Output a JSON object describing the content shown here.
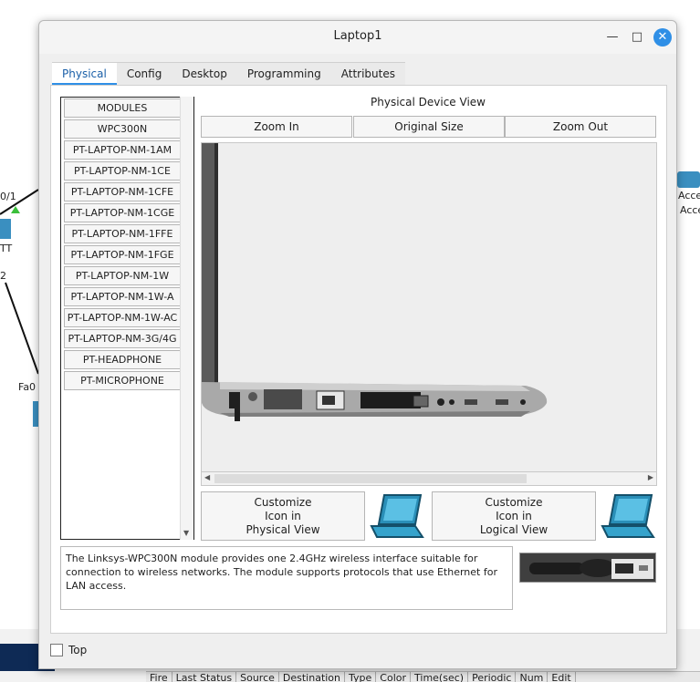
{
  "window": {
    "title": "Laptop1",
    "close_icon": "close-icon",
    "minimize_icon": "minimize-icon",
    "maximize_icon": "maximize-icon"
  },
  "tabs": [
    {
      "label": "Physical",
      "active": true
    },
    {
      "label": "Config",
      "active": false
    },
    {
      "label": "Desktop",
      "active": false
    },
    {
      "label": "Programming",
      "active": false
    },
    {
      "label": "Attributes",
      "active": false
    }
  ],
  "modules": {
    "items": [
      "MODULES",
      "WPC300N",
      "PT-LAPTOP-NM-1AM",
      "PT-LAPTOP-NM-1CE",
      "PT-LAPTOP-NM-1CFE",
      "PT-LAPTOP-NM-1CGE",
      "PT-LAPTOP-NM-1FFE",
      "PT-LAPTOP-NM-1FGE",
      "PT-LAPTOP-NM-1W",
      "PT-LAPTOP-NM-1W-A",
      "PT-LAPTOP-NM-1W-AC",
      "PT-LAPTOP-NM-3G/4G",
      "PT-HEADPHONE",
      "PT-MICROPHONE"
    ]
  },
  "device_view": {
    "title": "Physical Device View",
    "zoom_in": "Zoom In",
    "original_size": "Original Size",
    "zoom_out": "Zoom Out"
  },
  "customize": {
    "physical": [
      "Customize",
      "Icon in",
      "Physical View"
    ],
    "logical": [
      "Customize",
      "Icon in",
      "Logical View"
    ]
  },
  "description": "The Linksys-WPC300N module provides one 2.4GHz wireless interface suitable for connection to wireless networks. The module supports protocols that use Ethernet for LAN access.",
  "footer": {
    "top_label": "Top",
    "top_checked": false
  },
  "background": {
    "labels": [
      "0/1",
      "TT",
      "2",
      "Fa0",
      "Acce",
      "Acce"
    ],
    "event_columns": [
      "Fire",
      "Last Status",
      "Source",
      "Destination",
      "Type",
      "Color",
      "Time(sec)",
      "Periodic",
      "Num",
      "Edit"
    ]
  },
  "colors": {
    "accent": "#2f8fe6",
    "dark_navy": "#0e2a55"
  }
}
